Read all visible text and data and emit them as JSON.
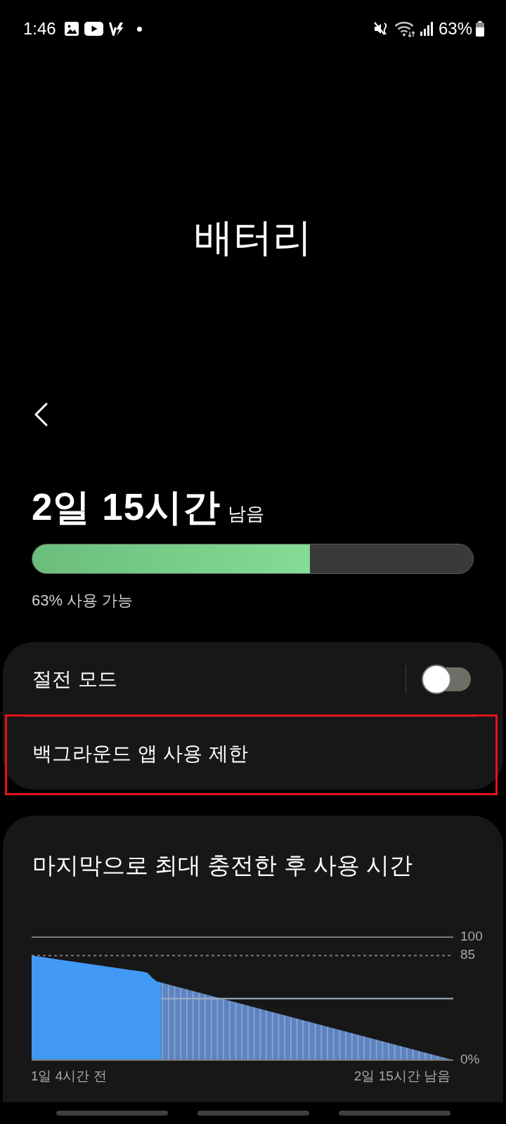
{
  "status_bar": {
    "time": "1:46",
    "battery": "63%"
  },
  "header": {
    "title": "배터리"
  },
  "summary": {
    "time_left": "2일 15시간",
    "suffix": "남음",
    "level": 0.63,
    "caption": "63% 사용 가능"
  },
  "settings": [
    {
      "kind": "toggle",
      "label": "절전 모드",
      "on": false,
      "highlighted": false
    },
    {
      "kind": "link",
      "label": "백그라운드 앱 사용 제한",
      "highlighted": true
    }
  ],
  "usage": {
    "title": "마지막으로 최대 충전한 후 사용 시간",
    "chart_data": {
      "type": "area",
      "categories": [
        null,
        null,
        null,
        null,
        null,
        null,
        null,
        null,
        "1일 4시간 전",
        null,
        null,
        null,
        null,
        null,
        null,
        null,
        null,
        null,
        null,
        null,
        null,
        null,
        null,
        null,
        null,
        null,
        null,
        null,
        null,
        null,
        null,
        null,
        null,
        null,
        null,
        null,
        null,
        null,
        null,
        null,
        null,
        null,
        null,
        null,
        null,
        null,
        null,
        null,
        null,
        null,
        null,
        null,
        null,
        null,
        null,
        null,
        null,
        null,
        null,
        null,
        null,
        null,
        null,
        null,
        null,
        null,
        null,
        null,
        null,
        null,
        null,
        null,
        null,
        null,
        null,
        null,
        null,
        null,
        null,
        null,
        "2일 15시간 남음",
        null,
        null,
        null,
        null,
        null,
        null,
        null,
        null,
        null,
        null,
        null
      ],
      "series": [
        {
          "color": "#4299f5",
          "values": [
            85,
            84.5,
            84,
            83.4,
            82.8,
            82.3,
            81.7,
            81.2,
            80.6,
            80.1,
            79.5,
            79,
            78.4,
            77.9,
            77.3,
            76.8,
            76.2,
            75.7,
            75.1,
            74.6,
            74,
            73.5,
            73,
            72.5,
            72,
            71,
            67,
            64,
            63,
            null,
            null,
            null,
            null,
            null,
            null,
            null,
            null,
            null,
            null,
            null,
            null,
            null,
            null,
            null,
            null,
            null,
            null,
            null,
            null,
            null,
            null,
            null,
            null,
            null,
            null,
            null,
            null,
            null,
            null,
            null,
            null,
            null,
            null,
            null,
            null,
            null,
            null,
            null,
            null,
            null,
            null,
            null,
            null,
            null,
            null,
            null,
            null,
            null,
            null,
            null,
            null,
            null,
            null,
            null,
            null,
            null,
            null,
            null,
            null,
            null,
            null,
            null
          ]
        },
        {
          "color": "#5d84c0",
          "values": [
            null,
            null,
            null,
            null,
            null,
            null,
            null,
            null,
            null,
            null,
            null,
            null,
            null,
            null,
            null,
            null,
            null,
            null,
            null,
            null,
            null,
            null,
            null,
            null,
            null,
            null,
            null,
            null,
            63,
            62,
            61,
            60,
            59,
            58,
            57,
            56,
            55,
            54,
            53,
            52,
            51,
            50,
            49,
            48,
            47,
            46,
            45,
            44,
            43,
            42,
            41,
            40,
            39,
            38,
            37,
            36,
            35,
            34,
            33,
            32,
            31,
            30,
            29,
            28,
            27,
            26,
            25,
            24,
            23,
            22,
            21,
            20,
            19,
            18,
            17,
            16,
            15,
            14,
            13,
            12,
            11,
            10,
            9,
            8,
            7,
            6,
            5,
            4,
            3,
            2,
            1,
            0
          ]
        }
      ],
      "ylim": [
        0,
        100
      ],
      "yticks": [
        {
          "value": 0,
          "label": "0%"
        },
        {
          "value": 85,
          "label": "85"
        },
        {
          "value": 100,
          "label": "100"
        }
      ],
      "ref_lines": [
        {
          "axis": "y",
          "value": 50
        }
      ]
    }
  }
}
